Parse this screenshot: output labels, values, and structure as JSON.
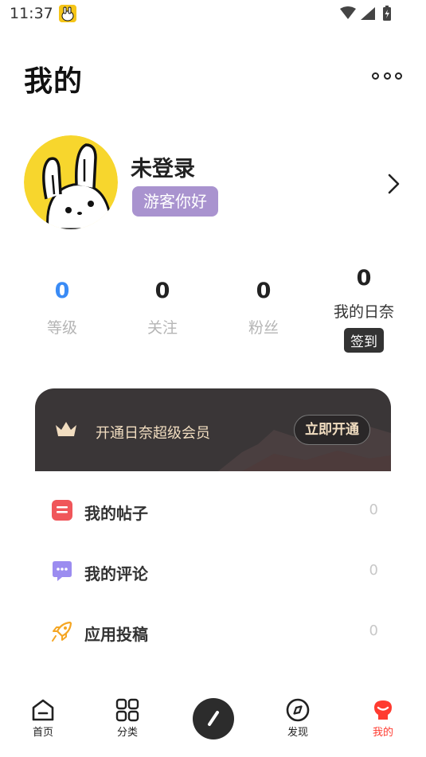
{
  "status": {
    "time": "11:37"
  },
  "header": {
    "title": "我的"
  },
  "profile": {
    "name": "未登录",
    "badge": "游客你好"
  },
  "stats": [
    {
      "value": "0",
      "label": "等级"
    },
    {
      "value": "0",
      "label": "关注"
    },
    {
      "value": "0",
      "label": "粉丝"
    }
  ],
  "rinai": {
    "value": "0",
    "label": "我的日奈",
    "button": "签到"
  },
  "vip": {
    "text": "开通日奈超级会员",
    "button": "立即开通"
  },
  "menu": [
    {
      "label": "我的帖子",
      "count": "0",
      "icon": "post-icon"
    },
    {
      "label": "我的评论",
      "count": "0",
      "icon": "comment-icon"
    },
    {
      "label": "应用投稿",
      "count": "0",
      "icon": "rocket-icon"
    }
  ],
  "tabs": [
    {
      "label": "首页",
      "icon": "home-icon"
    },
    {
      "label": "分类",
      "icon": "category-icon"
    },
    {
      "label": "发现",
      "icon": "compass-icon"
    },
    {
      "label": "我的",
      "icon": "mine-icon"
    }
  ],
  "colors": {
    "accent": "#ff3b30",
    "level": "#3a8bf5",
    "badge": "#a993cf",
    "vip_bg": "#3a3637",
    "vip_text": "#f1ddc0"
  }
}
